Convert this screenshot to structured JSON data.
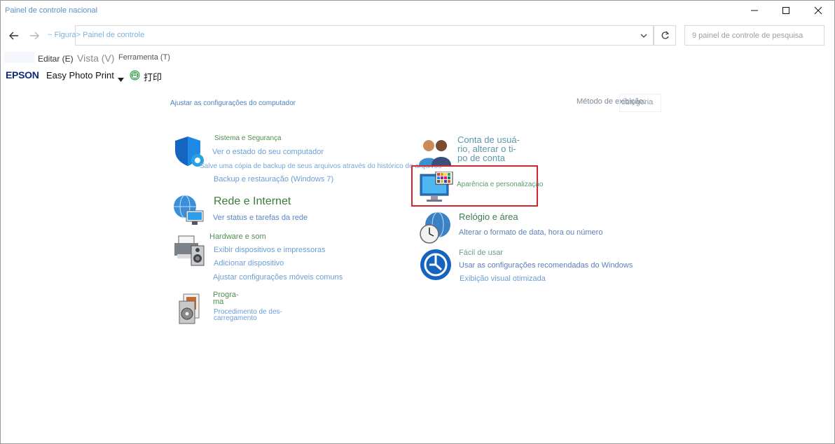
{
  "window": {
    "title": "Painel de controle nacional"
  },
  "address_bar": {
    "path": "~ Figura> Painel de controle",
    "search_placeholder": "9 painel de controle de pesquisa"
  },
  "menu": {
    "edit": "Editar (E)",
    "view": "Vista (V)",
    "tools": "Ferramenta (T)"
  },
  "epson_toolbar": {
    "brand": "EPSON",
    "app": "Easy Photo Print",
    "print": "打印"
  },
  "content": {
    "heading": "Ajustar as configurações do computador",
    "view_by_label": "Método de exibição:",
    "view_by_value": "categoria"
  },
  "categories": {
    "system": {
      "title": "Sistema e Segurança",
      "links": [
        "Ver o estado do seu computador",
        "Salve uma cópia de backup de seus arquivos através do histórico de arquivos",
        "Backup e restauração (Windows 7)"
      ]
    },
    "network": {
      "title": "Rede e Internet",
      "links": [
        "Ver status e tarefas da rede"
      ]
    },
    "hardware": {
      "title": "Hardware e som",
      "links": [
        "Exibir dispositivos e impressoras",
        "Adicionar dispositivo",
        "Ajustar configurações móveis comuns"
      ]
    },
    "programs": {
      "title_line1": "Progra-",
      "title_line2": "ma",
      "link_line1": "Procedimento de des-",
      "link_line2": "carregamento"
    },
    "accounts": {
      "title_line1": "Conta de usuá-",
      "title_line2": "rio, alterar o ti-",
      "title_line3": "po de conta"
    },
    "appearance": {
      "title": "Aparência e personalização"
    },
    "clock": {
      "title": "Relógio e área",
      "links": [
        "Alterar o formato de data, hora ou número"
      ]
    },
    "ease": {
      "title": "Fácil de usar",
      "links": [
        "Usar as configurações recomendadas do Windows",
        "Exibição visual otimizada"
      ]
    }
  },
  "colors": {
    "highlight": "#d0282e",
    "link": "#6a9ed6",
    "category_title": "#3c7a3c"
  }
}
